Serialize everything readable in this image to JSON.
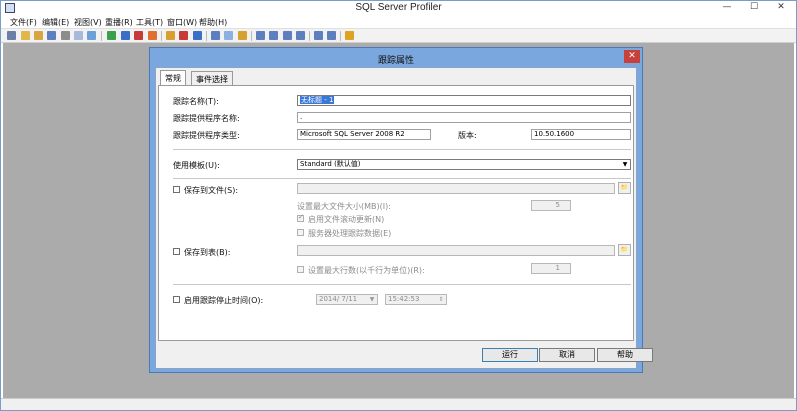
{
  "app": {
    "title": "SQL Server Profiler",
    "window_controls": {
      "minimize": "—",
      "maximize": "☐",
      "close": "✕"
    }
  },
  "menu": [
    "文件(F)",
    "编辑(E)",
    "视图(V)",
    "重播(R)",
    "工具(T)",
    "窗口(W)",
    "帮助(H)"
  ],
  "dialog": {
    "title": "跟踪属性",
    "close_label": "✕",
    "tabs": [
      "常规",
      "事件选择"
    ],
    "trace_name": {
      "label": "跟踪名称(T):",
      "value": "无标题 - 1"
    },
    "provider_name": {
      "label": "跟踪提供程序名称:",
      "value": "."
    },
    "provider_type": {
      "label": "跟踪提供程序类型:",
      "value": "Microsoft SQL Server 2008 R2"
    },
    "version": {
      "label": "版本:",
      "value": "10.50.1600"
    },
    "template": {
      "label": "使用模板(U):",
      "value": "Standard (默认值)"
    },
    "save_to_file": {
      "label": "保存到文件(S):",
      "max_size_label": "设置最大文件大小(MB)(I):",
      "max_size_value": "5",
      "rollover_label": "启用文件滚动更新(N)",
      "server_processes_label": "服务器处理跟踪数据(E)"
    },
    "save_to_table": {
      "label": "保存到表(B):",
      "max_rows_label": "设置最大行数(以千行为单位)(R):",
      "max_rows_value": "1"
    },
    "stop_time": {
      "label": "启用跟踪停止时间(O):",
      "date": "2014/ 7/11",
      "time": "15:42:53"
    },
    "buttons": {
      "run": "运行",
      "cancel": "取消",
      "help": "帮助"
    }
  }
}
